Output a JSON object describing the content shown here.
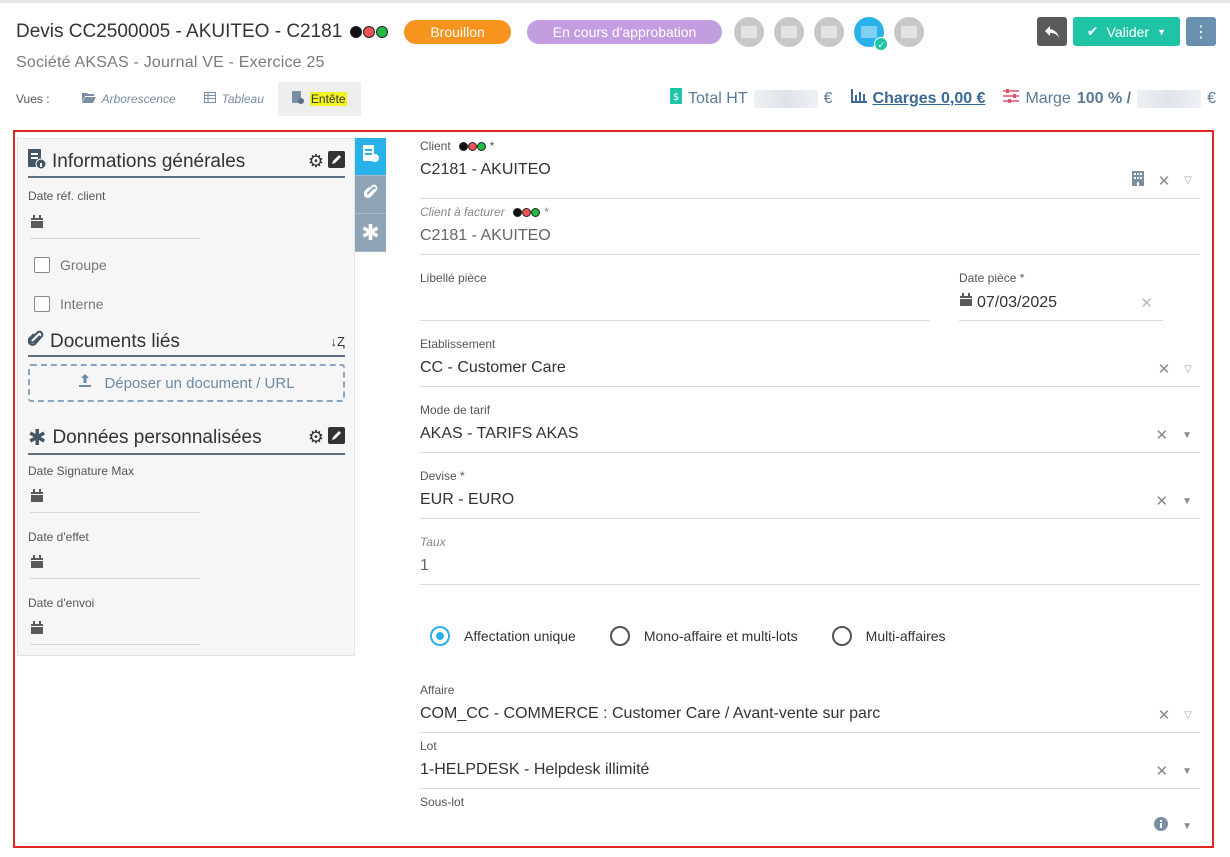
{
  "header": {
    "title": "Devis  CC2500005  -  AKUITEO  -  C2181",
    "dots": [
      "#111111",
      "#ee5555",
      "#22bb44"
    ],
    "badges": [
      {
        "label": "Brouillon",
        "color": "#f7941d"
      },
      {
        "label": "En cours d'approbation",
        "color": "#c29de0"
      }
    ],
    "subtitle": "Société AKSAS  -  Journal VE  -  Exercice 25",
    "validate_label": "Valider"
  },
  "views": {
    "label": "Vues :",
    "items": [
      {
        "label": "Arborescence",
        "icon": "folder-open-icon"
      },
      {
        "label": "Tableau",
        "icon": "table-icon"
      },
      {
        "label": "Entête",
        "icon": "doc-info-icon"
      }
    ]
  },
  "totals": {
    "total_ht_label": "Total HT",
    "total_ht_currency": "€",
    "charges_label": "Charges 0,00 €",
    "marge_label": "Marge",
    "marge_value": "100 % /",
    "marge_currency": "€"
  },
  "left": {
    "info_title": "Informations générales",
    "date_ref_label": "Date réf. client",
    "groupe_label": "Groupe",
    "interne_label": "Interne",
    "docs_title": "Documents liés",
    "drop_label": "Déposer un document / URL",
    "custom_title": "Données personnalisées",
    "date_sig_label": "Date Signature Max",
    "date_effet_label": "Date d'effet",
    "date_envoi_label": "Date d'envoi"
  },
  "form": {
    "client_label": "Client",
    "client_value": "C2181 - AKUITEO",
    "client_fact_label": "Client à facturer",
    "client_fact_value": "C2181 - AKUITEO",
    "libelle_label": "Libellé pièce",
    "date_piece_label": "Date pièce *",
    "date_piece_value": "07/03/2025",
    "etab_label": "Etablissement",
    "etab_value": "CC - Customer Care",
    "tarif_label": "Mode de tarif",
    "tarif_value": "AKAS - TARIFS AKAS",
    "devise_label": "Devise *",
    "devise_value": "EUR - EURO",
    "taux_label": "Taux",
    "taux_value": "1",
    "radio_options": [
      "Affectation unique",
      "Mono-affaire et multi-lots",
      "Multi-affaires"
    ],
    "radio_selected": "Affectation unique",
    "affaire_label": "Affaire",
    "affaire_value": "COM_CC - COMMERCE : Customer Care / Avant-vente sur parc",
    "lot_label": "Lot",
    "lot_value": "1-HELPDESK - Helpdesk illimité",
    "souslot_label": "Sous-lot"
  }
}
